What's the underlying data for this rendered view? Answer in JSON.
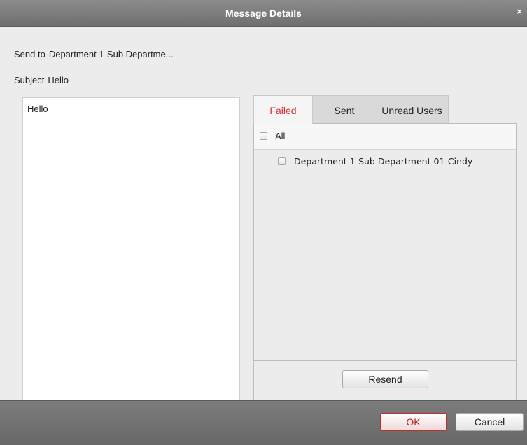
{
  "dialog": {
    "title": "Message Details"
  },
  "send_to": {
    "label": "Send to",
    "value": "Department 1-Sub Departme..."
  },
  "subject": {
    "label": "Subject",
    "value": "Hello"
  },
  "message": {
    "body": "Hello"
  },
  "tabs": [
    {
      "label": "Failed",
      "active": true
    },
    {
      "label": "Sent",
      "active": false
    },
    {
      "label": "Unread Users",
      "active": false
    }
  ],
  "recipients": {
    "all_label": "All",
    "items": [
      {
        "label": "Department 1-Sub Department 01-Cindy",
        "checked": false
      }
    ]
  },
  "buttons": {
    "resend": "Resend",
    "ok": "OK",
    "cancel": "Cancel"
  },
  "icons": {
    "close": "close-icon"
  },
  "colors": {
    "active_tab": "#d13030",
    "titlebar": "#7f7f7f"
  }
}
